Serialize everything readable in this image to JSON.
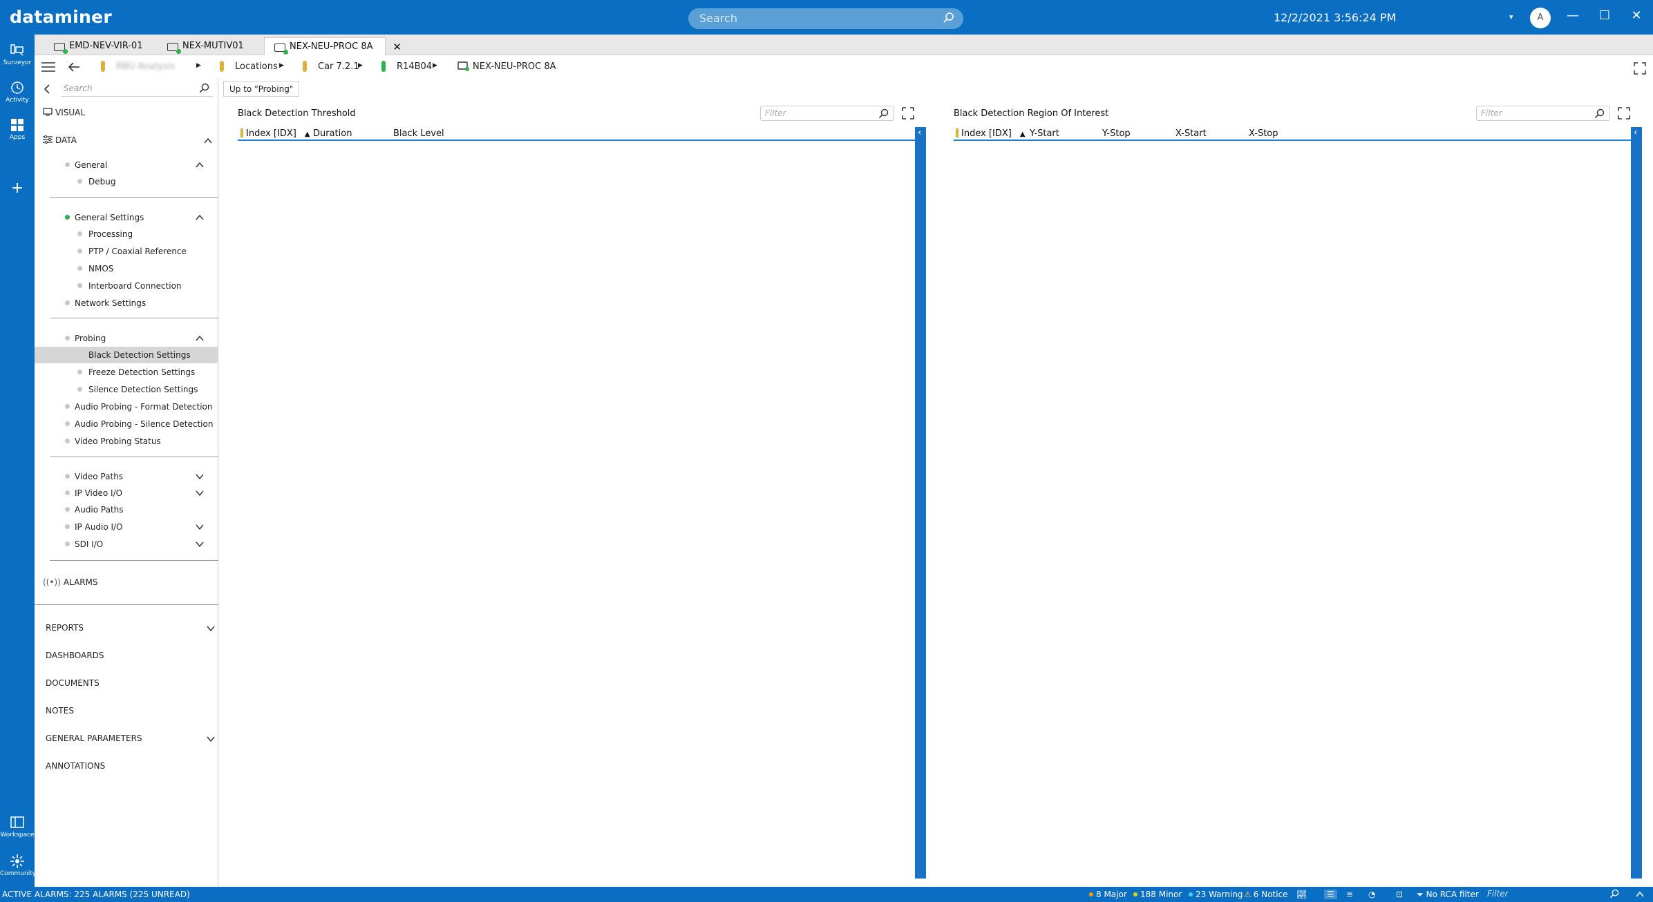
{
  "titlebar": {
    "logo": "dataminer",
    "search_placeholder": "Search",
    "datetime": "12/2/2021 3:56:24 PM",
    "avatar": "A"
  },
  "rail": {
    "surveyor": "Surveyor",
    "activity": "Activity",
    "apps": "Apps",
    "workspace": "Workspace",
    "community": "Community"
  },
  "tabs": [
    {
      "label": "EMD-NEV-VIR-01"
    },
    {
      "label": "NEX-MUTIV01"
    },
    {
      "label": "NEX-NEU-PROC 8A"
    }
  ],
  "breadcrumb": {
    "view": "RBU Analysis",
    "locations": "Locations",
    "car": "Car 7.2.1",
    "rack": "R14B04",
    "element": "NEX-NEU-PROC 8A"
  },
  "sidebar": {
    "search_placeholder": "Search",
    "visual": "VISUAL",
    "data": "DATA",
    "items": {
      "general": "General",
      "debug": "Debug",
      "general_settings": "General Settings",
      "processing": "Processing",
      "ptp": "PTP / Coaxial Reference",
      "nmos": "NMOS",
      "interboard": "Interboard Connection",
      "network": "Network Settings",
      "probing": "Probing",
      "black": "Black Detection Settings",
      "freeze": "Freeze Detection Settings",
      "silence": "Silence Detection Settings",
      "audio_format": "Audio Probing - Format Detection",
      "audio_silence": "Audio Probing - Silence Detection",
      "video_status": "Video Probing Status",
      "video_paths": "Video Paths",
      "ip_video": "IP Video I/O",
      "audio_paths": "Audio Paths",
      "ip_audio": "IP Audio I/O",
      "sdi": "SDI I/O"
    },
    "alarms": "ALARMS",
    "reports": "REPORTS",
    "dashboards": "DASHBOARDS",
    "documents": "DOCUMENTS",
    "notes": "NOTES",
    "general_parameters": "GENERAL PARAMETERS",
    "annotations": "ANNOTATIONS"
  },
  "content": {
    "up_button": "Up to \"Probing\"",
    "left_panel": {
      "title": "Black Detection Threshold",
      "filter_placeholder": "Filter",
      "columns": [
        "Index [IDX]",
        "Duration",
        "Black Level"
      ]
    },
    "right_panel": {
      "title": "Black Detection Region Of Interest",
      "filter_placeholder": "Filter",
      "columns": [
        "Index [IDX]",
        "Y-Start",
        "Y-Stop",
        "X-Start",
        "X-Stop"
      ]
    }
  },
  "statusbar": {
    "active_alarms": "ACTIVE ALARMS: 225 ALARMS (225 UNREAD)",
    "major": "8 Major",
    "minor": "188 Minor",
    "warning": "23 Warning",
    "notice": "6 Notice",
    "rca": "No RCA filter",
    "filter_placeholder": "Filter",
    "colors": {
      "major": "#f0a000",
      "minor": "#f5d000",
      "warning": "#4ad0f0",
      "notice": "#ffd24a"
    }
  },
  "colors": {
    "brand": "#0a6fc2",
    "accent_bar": "#1a72c7",
    "status_green": "#2bb24c",
    "status_yellow": "#d9b23b"
  }
}
